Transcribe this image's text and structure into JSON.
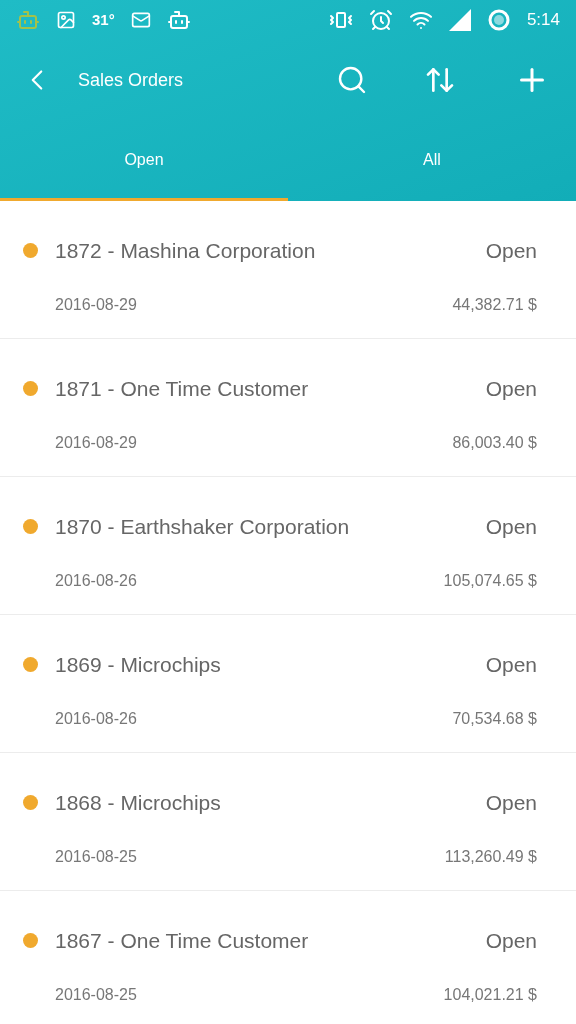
{
  "status_bar": {
    "temperature": "31°",
    "time": "5:14"
  },
  "toolbar": {
    "title": "Sales Orders"
  },
  "tabs": [
    {
      "label": "Open",
      "selected": true
    },
    {
      "label": "All",
      "selected": false
    }
  ],
  "orders": [
    {
      "title": "1872 - Mashina Corporation",
      "status": "Open",
      "date": "2016-08-29",
      "amount": "44,382.71 $",
      "color": "#f0a92e"
    },
    {
      "title": "1871 - One Time Customer",
      "status": "Open",
      "date": "2016-08-29",
      "amount": "86,003.40 $",
      "color": "#f0a92e"
    },
    {
      "title": "1870 - Earthshaker Corporation",
      "status": "Open",
      "date": "2016-08-26",
      "amount": "105,074.65 $",
      "color": "#f0a92e"
    },
    {
      "title": "1869 - Microchips",
      "status": "Open",
      "date": "2016-08-26",
      "amount": "70,534.68 $",
      "color": "#f0a92e"
    },
    {
      "title": "1868 - Microchips",
      "status": "Open",
      "date": "2016-08-25",
      "amount": "113,260.49 $",
      "color": "#f0a92e"
    },
    {
      "title": "1867 - One Time Customer",
      "status": "Open",
      "date": "2016-08-25",
      "amount": "104,021.21 $",
      "color": "#f0a92e"
    }
  ]
}
